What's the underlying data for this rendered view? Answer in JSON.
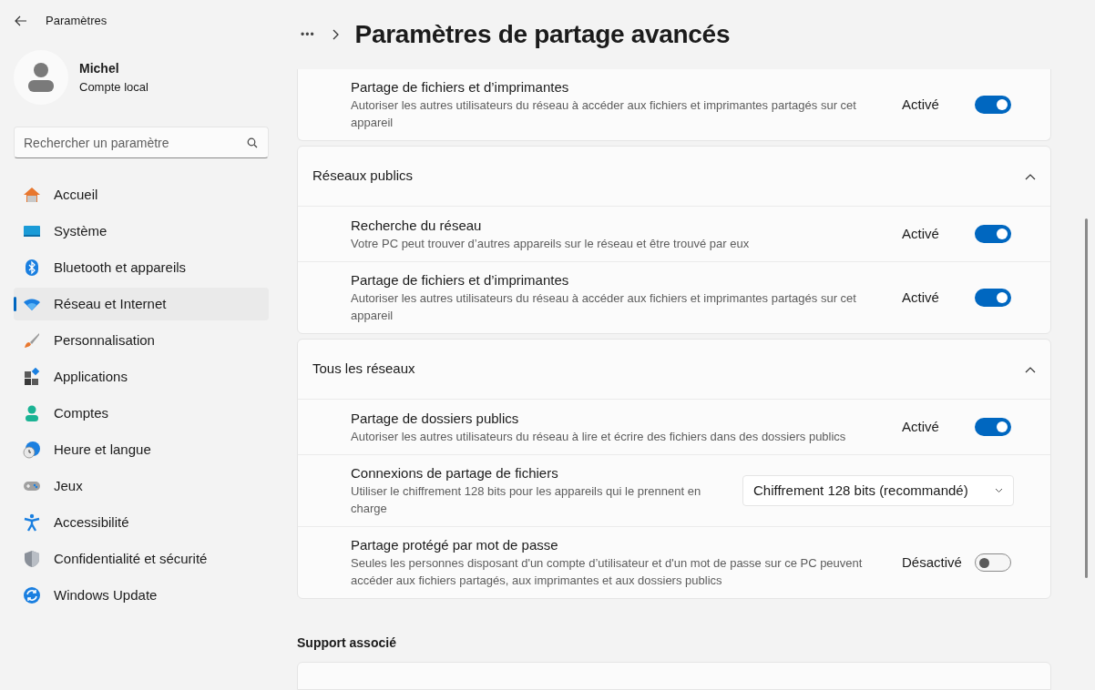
{
  "window": {
    "title": "Paramètres"
  },
  "user": {
    "name": "Michel",
    "account": "Compte local"
  },
  "search": {
    "placeholder": "Rechercher un paramètre"
  },
  "sidebar": {
    "items": [
      {
        "label": "Accueil",
        "selected": false
      },
      {
        "label": "Système",
        "selected": false
      },
      {
        "label": "Bluetooth et appareils",
        "selected": false
      },
      {
        "label": "Réseau et Internet",
        "selected": true
      },
      {
        "label": "Personnalisation",
        "selected": false
      },
      {
        "label": "Applications",
        "selected": false
      },
      {
        "label": "Comptes",
        "selected": false
      },
      {
        "label": "Heure et langue",
        "selected": false
      },
      {
        "label": "Jeux",
        "selected": false
      },
      {
        "label": "Accessibilité",
        "selected": false
      },
      {
        "label": "Confidentialité et sécurité",
        "selected": false
      },
      {
        "label": "Windows Update",
        "selected": false
      }
    ]
  },
  "breadcrumb": {
    "more": "•••",
    "title": "Paramètres de partage avancés"
  },
  "sections": [
    {
      "rows": [
        {
          "kind": "toggle",
          "title": "Partage de fichiers et d’imprimantes",
          "description": "Autoriser les autres utilisateurs du réseau à accéder aux fichiers et imprimantes partagés sur cet appareil",
          "status": "Activé",
          "on": true
        }
      ]
    },
    {
      "title": "Réseaux publics",
      "expanded": true,
      "rows": [
        {
          "kind": "toggle",
          "title": "Recherche du réseau",
          "description": "Votre PC peut trouver d’autres appareils sur le réseau et être trouvé par eux",
          "status": "Activé",
          "on": true
        },
        {
          "kind": "toggle",
          "title": "Partage de fichiers et d’imprimantes",
          "description": "Autoriser les autres utilisateurs du réseau à accéder aux fichiers et imprimantes partagés sur cet appareil",
          "status": "Activé",
          "on": true
        }
      ]
    },
    {
      "title": "Tous les réseaux",
      "expanded": true,
      "rows": [
        {
          "kind": "toggle",
          "title": "Partage de dossiers publics",
          "description": "Autoriser les autres utilisateurs du réseau à lire et écrire des fichiers dans des dossiers publics",
          "status": "Activé",
          "on": true
        },
        {
          "kind": "dropdown",
          "title": "Connexions de partage de fichiers",
          "description": "Utiliser le chiffrement 128 bits pour les appareils qui le prennent en charge",
          "value": "Chiffrement 128 bits (recommandé)"
        },
        {
          "kind": "toggle",
          "title": "Partage protégé par mot de passe",
          "description": "Seules les personnes disposant d'un compte d’utilisateur et d'un mot de passe sur ce PC peuvent accéder aux fichiers partagés, aux imprimantes et aux dossiers publics",
          "status": "Désactivé",
          "on": false
        }
      ]
    }
  ],
  "related": {
    "title": "Support associé"
  }
}
